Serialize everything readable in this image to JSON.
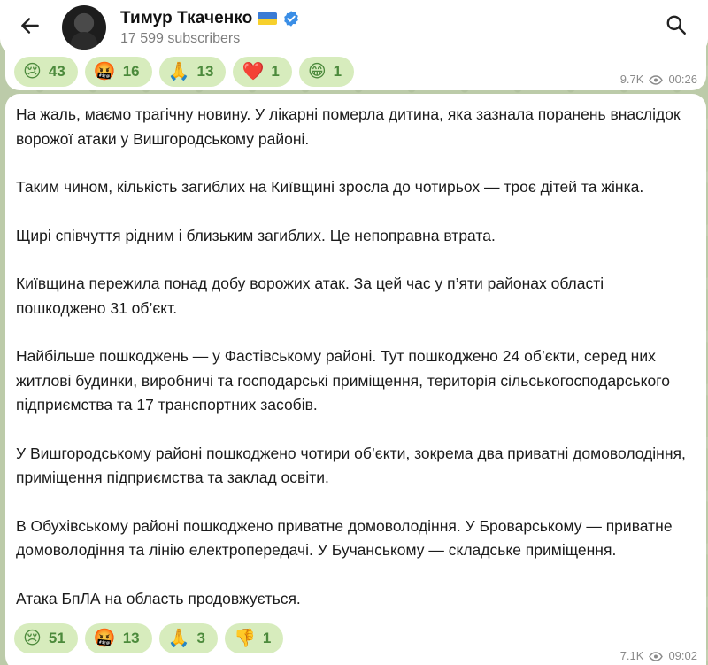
{
  "header": {
    "channel_name": "Тимур Ткаченко",
    "subscribers": "17 599 subscribers"
  },
  "icons": {
    "back": "arrow-left-icon",
    "search": "search-icon",
    "verified": "verified-badge-icon",
    "flag": "ukraine-flag-icon",
    "views": "eye-icon"
  },
  "colors": {
    "accent": "#4c8a3c",
    "reaction_bg": "#d7ecbd",
    "verified": "#3a8ee6"
  },
  "message_top": {
    "reactions": [
      {
        "emoji": "😢",
        "count": "43"
      },
      {
        "emoji": "🤬",
        "count": "16"
      },
      {
        "emoji": "🙏",
        "count": "13"
      },
      {
        "emoji": "❤️",
        "count": "1"
      },
      {
        "emoji": "😁",
        "count": "1"
      }
    ],
    "views": "9.7K",
    "time": "00:26"
  },
  "message_main": {
    "paragraphs": [
      "На жаль, маємо трагічну новину. У лікарні померла дитина, яка зазнала поранень внаслідок ворожої атаки у Вишгородському районі.",
      "Таким чином, кількість загиблих на Київщині зросла до чотирьох — троє дітей та жінка.",
      "Щирі співчуття рідним і близьким загиблих. Це непоправна втрата.",
      "Київщина пережила понад добу ворожих атак. За цей час у п’яти районах області пошкоджено 31 об’єкт.",
      "Найбільше пошкоджень — у Фастівському районі. Тут пошкоджено 24 об’єкти, серед них житлові будинки, виробничі та господарські приміщення, територія сільськогосподарського підприємства та 17 транспортних засобів.",
      "У Вишгородському районі пошкоджено чотири об’єкти, зокрема два приватні домоволодіння, приміщення підприємства та заклад освіти.",
      "В Обухівському районі пошкоджено приватне домоволодіння. У Броварському — приватне домоволодіння та лінію електропередачі. У Бучанському — складське приміщення.",
      "Атака БпЛА на область продовжується."
    ],
    "reactions": [
      {
        "emoji": "😢",
        "count": "51"
      },
      {
        "emoji": "🤬",
        "count": "13"
      },
      {
        "emoji": "🙏",
        "count": "3"
      },
      {
        "emoji": "👎",
        "count": "1"
      }
    ],
    "views": "7.1K",
    "time": "09:02"
  }
}
